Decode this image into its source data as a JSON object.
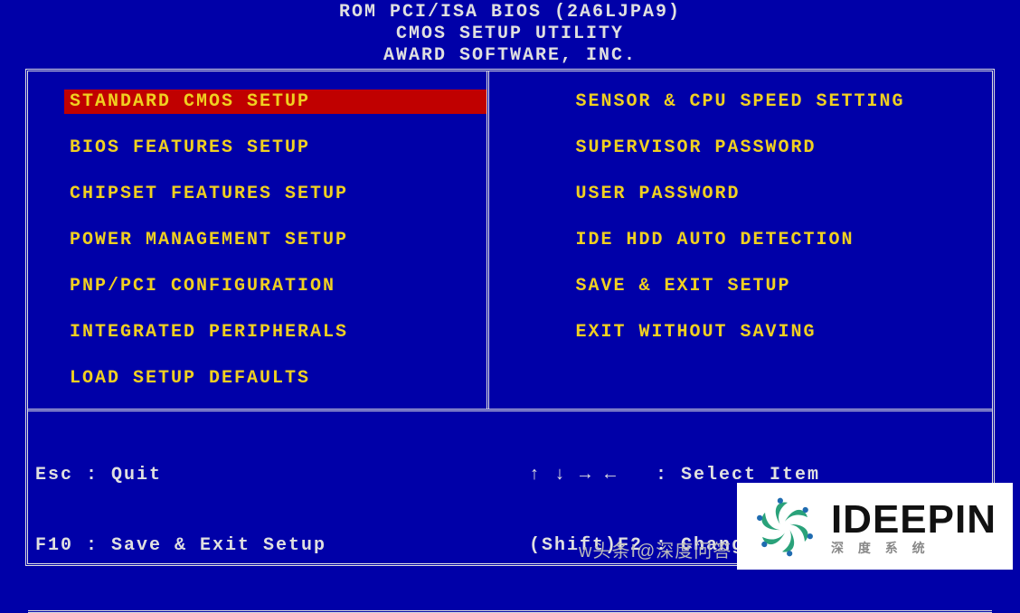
{
  "header": {
    "line1": "ROM PCI/ISA BIOS (2A6LJPA9)",
    "line2": "CMOS SETUP UTILITY",
    "line3": "AWARD SOFTWARE, INC."
  },
  "menu_left": [
    {
      "label": "STANDARD CMOS SETUP",
      "selected": true
    },
    {
      "label": "BIOS FEATURES SETUP",
      "selected": false
    },
    {
      "label": "CHIPSET FEATURES SETUP",
      "selected": false
    },
    {
      "label": "POWER MANAGEMENT SETUP",
      "selected": false
    },
    {
      "label": "PNP/PCI CONFIGURATION",
      "selected": false
    },
    {
      "label": "INTEGRATED PERIPHERALS",
      "selected": false
    },
    {
      "label": "LOAD SETUP DEFAULTS",
      "selected": false
    }
  ],
  "menu_right": [
    {
      "label": "SENSOR & CPU SPEED SETTING",
      "selected": false
    },
    {
      "label": "SUPERVISOR PASSWORD",
      "selected": false
    },
    {
      "label": "USER PASSWORD",
      "selected": false
    },
    {
      "label": "IDE HDD AUTO DETECTION",
      "selected": false
    },
    {
      "label": "SAVE & EXIT SETUP",
      "selected": false
    },
    {
      "label": "EXIT WITHOUT SAVING",
      "selected": false
    }
  ],
  "hints": {
    "left_line1": "Esc : Quit",
    "left_line2": "F10 : Save & Exit Setup",
    "right_line1": "↑ ↓ → ←   : Select Item",
    "right_line2": "(Shift)F2 : Change Color"
  },
  "watermark": {
    "title": "IDEEPIN",
    "subtitle": "深 度 系 统",
    "overlay": "w头条I@深度问答"
  }
}
